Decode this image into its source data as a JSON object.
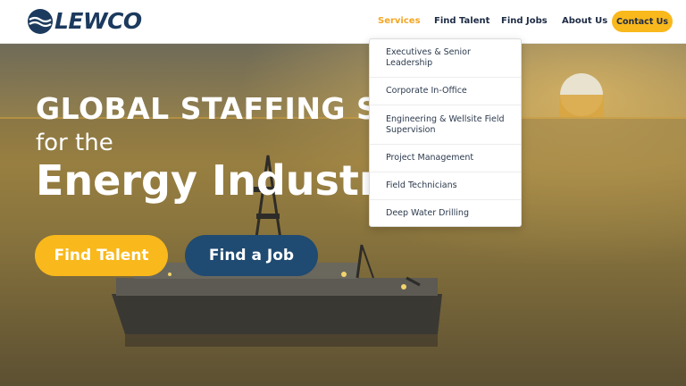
{
  "header": {
    "logo_text": "LEWCO",
    "nav": {
      "services": "Services",
      "find_talent": "Find Talent",
      "find_jobs": "Find Jobs",
      "about_us": "About Us",
      "contact_us": "Contact Us"
    }
  },
  "services_menu": {
    "items": [
      "Executives & Senior Leadership",
      "Corporate In-Office",
      "Engineering & Wellsite Field Supervision",
      "Project Management",
      "Field Technicians",
      "Deep Water Drilling"
    ]
  },
  "hero": {
    "title_line1": "GLOBAL STAFFING SOL",
    "title_line2": "for the",
    "title_line3": "Energy Industr",
    "find_talent_button": "Find Talent",
    "find_job_button": "Find a Job"
  },
  "colors": {
    "brand_navy": "#1c3a5e",
    "accent_yellow": "#f9b81b",
    "active_nav": "#f5a623",
    "button_blue": "#1f4a72"
  }
}
